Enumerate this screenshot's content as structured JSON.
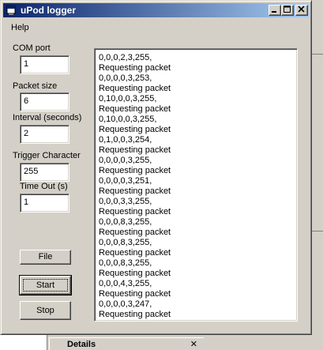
{
  "window": {
    "title": "uPod logger",
    "icon": "app-icon",
    "controls": [
      "minimize",
      "maximize",
      "close"
    ]
  },
  "menu": {
    "help": "Help"
  },
  "form": {
    "com_port": {
      "label": "COM port",
      "value": "1"
    },
    "packet_size": {
      "label": "Packet size",
      "value": "6"
    },
    "interval": {
      "label": "Interval (seconds)",
      "value": "2"
    },
    "trigger_char": {
      "label": "Trigger Character",
      "value": "255"
    },
    "timeout": {
      "label": "Time Out (s)",
      "value": "1"
    }
  },
  "buttons": {
    "file": "File",
    "start": "Start",
    "stop": "Stop"
  },
  "log": {
    "lines": [
      "0,0,0,2,3,255,",
      "Requesting packet",
      "0,0,0,0,3,253,",
      "Requesting packet",
      "0,10,0,0,3,255,",
      "Requesting packet",
      "0,10,0,0,3,255,",
      "Requesting packet",
      "0,1,0,0,3,254,",
      "Requesting packet",
      "0,0,0,0,3,255,",
      "Requesting packet",
      "0,0,0,0,3,251,",
      "Requesting packet",
      "0,0,0,3,3,255,",
      "Requesting packet",
      "0,0,0,8,3,255,",
      "Requesting packet",
      "0,0,0,8,3,255,",
      "Requesting packet",
      "0,0,0,8,3,255,",
      "Requesting packet",
      "0,0,0,4,3,255,",
      "Requesting packet",
      "0,0,0,0,3,247,",
      "Requesting packet"
    ]
  },
  "background": {
    "details_tab": "Details",
    "details_close": "✕"
  }
}
